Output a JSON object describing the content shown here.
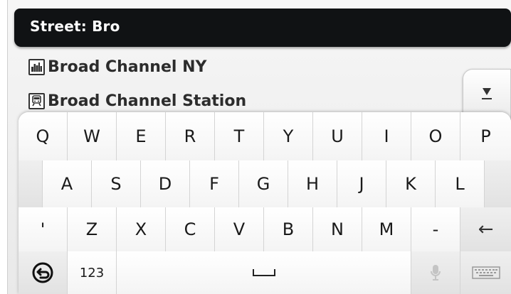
{
  "header": {
    "label": "Street:",
    "query": "Bro"
  },
  "results": [
    {
      "label": "Broad Channel NY",
      "icon": "city-skyline-icon"
    },
    {
      "label": "Broad Channel Station",
      "icon": "train-icon"
    }
  ],
  "keyboard": {
    "row1": [
      "Q",
      "W",
      "E",
      "R",
      "T",
      "Y",
      "U",
      "I",
      "O",
      "P"
    ],
    "row2": [
      "A",
      "S",
      "D",
      "F",
      "G",
      "H",
      "J",
      "K",
      "L"
    ],
    "row3": [
      "'",
      "Z",
      "X",
      "C",
      "V",
      "B",
      "N",
      "M",
      "-",
      "←"
    ],
    "row4": {
      "numbers_label": "123"
    }
  }
}
